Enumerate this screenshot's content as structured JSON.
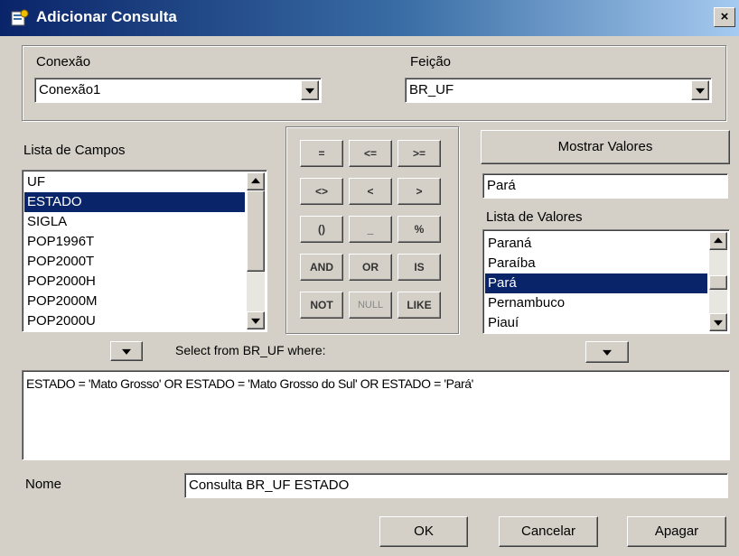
{
  "window": {
    "title": "Adicionar Consulta",
    "close_glyph": "×"
  },
  "connection": {
    "label": "Conexão",
    "value": "Conexão1"
  },
  "feature": {
    "label": "Feição",
    "value": "BR_UF"
  },
  "fields": {
    "label": "Lista de Campos",
    "items": [
      "UF",
      "ESTADO",
      "SIGLA",
      "POP1996T",
      "POP2000T",
      "POP2000H",
      "POP2000M",
      "POP2000U"
    ],
    "selected": "ESTADO"
  },
  "operators": {
    "row1": [
      "=",
      "<=",
      ">="
    ],
    "row2": [
      "<>",
      "<",
      ">"
    ],
    "row3": [
      "()",
      "_",
      "%"
    ],
    "row4": [
      "AND",
      "OR",
      "IS"
    ],
    "row5": [
      "NOT",
      "NULL",
      "LIKE"
    ]
  },
  "values": {
    "show_button": "Mostrar Valores",
    "search_value": "Pará",
    "label": "Lista de Valores",
    "items": [
      "Paraná",
      "Paraíba",
      "Pará",
      "Pernambuco",
      "Piauí"
    ],
    "selected": "Pará"
  },
  "query": {
    "select_label": "Select from BR_UF where:",
    "text": "ESTADO = 'Mato Grosso' OR ESTADO = 'Mato Grosso do Sul' OR ESTADO = 'Pará'"
  },
  "name": {
    "label": "Nome",
    "value": "Consulta BR_UF ESTADO"
  },
  "buttons": {
    "ok": "OK",
    "cancel": "Cancelar",
    "clear": "Apagar"
  }
}
